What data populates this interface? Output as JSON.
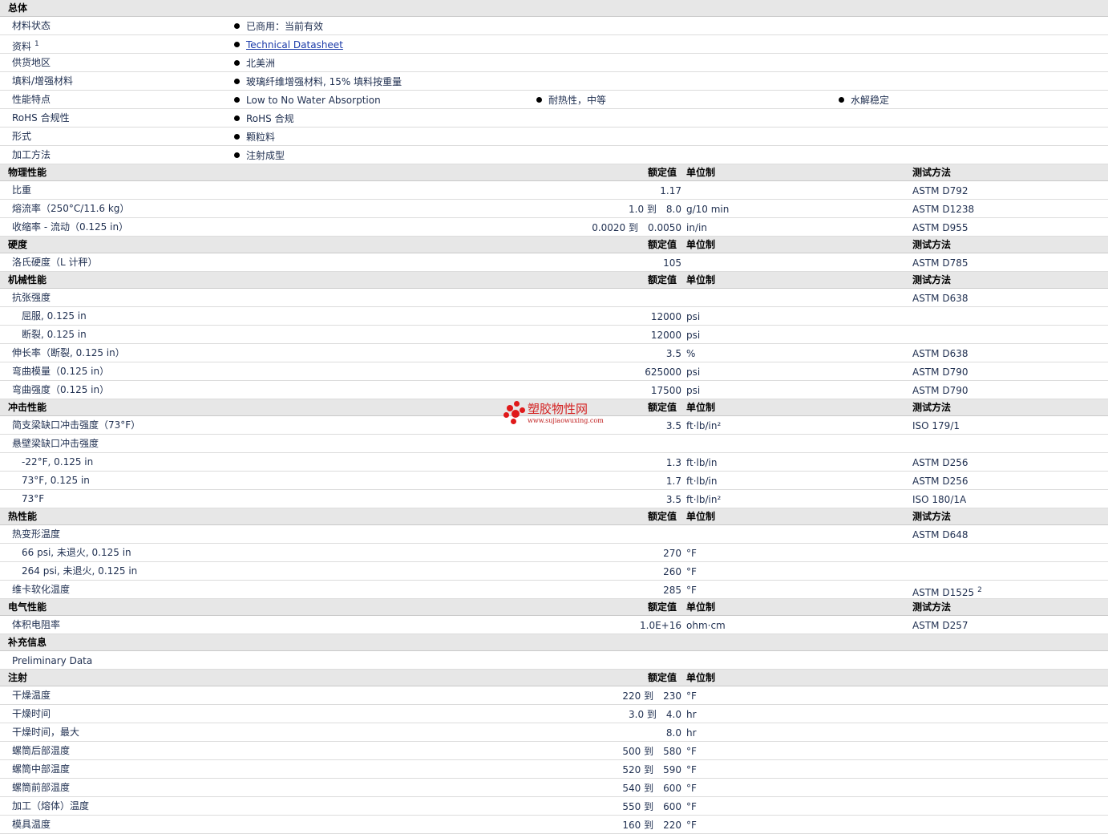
{
  "general": {
    "title": "总体",
    "rows": [
      {
        "label": "材料状态",
        "values": [
          "已商用：当前有效"
        ]
      },
      {
        "label": "资料",
        "sup": "1",
        "values": [
          "Technical Datasheet"
        ],
        "link": true
      },
      {
        "label": "供货地区",
        "values": [
          "北美洲"
        ]
      },
      {
        "label": "填料/增强材料",
        "values": [
          "玻璃纤维增强材料, 15% 填料按重量"
        ]
      },
      {
        "label": "性能特点",
        "values": [
          "Low to No Water Absorption",
          "耐热性，中等",
          "水解稳定"
        ]
      },
      {
        "label": "RoHS 合规性",
        "values": [
          "RoHS 合规"
        ]
      },
      {
        "label": "形式",
        "values": [
          "颗粒料"
        ]
      },
      {
        "label": "加工方法",
        "values": [
          "注射成型"
        ]
      }
    ]
  },
  "headers": {
    "nominal": "额定值",
    "unit": "单位制",
    "method": "测试方法"
  },
  "physical": {
    "title": "物理性能",
    "rows": [
      {
        "label": "比重",
        "nominal": "1.17",
        "unit": "",
        "method": "ASTM D792"
      },
      {
        "label": "熔流率（250°C/11.6 kg）",
        "nominal": "1.0 到　8.0",
        "unit": "g/10 min",
        "method": "ASTM D1238"
      },
      {
        "label": "收缩率 - 流动（0.125 in）",
        "nominal": "0.0020 到　0.0050",
        "unit": "in/in",
        "method": "ASTM D955"
      }
    ]
  },
  "hardness": {
    "title": "硬度",
    "rows": [
      {
        "label": "洛氏硬度（L 计秤）",
        "nominal": "105",
        "unit": "",
        "method": "ASTM D785"
      }
    ]
  },
  "mechanical": {
    "title": "机械性能",
    "rows": [
      {
        "label": "抗张强度",
        "nominal": "",
        "unit": "",
        "method": "ASTM D638"
      },
      {
        "label": "屈服, 0.125 in",
        "sub": true,
        "nominal": "12000",
        "unit": "psi",
        "method": ""
      },
      {
        "label": "断裂, 0.125 in",
        "sub": true,
        "nominal": "12000",
        "unit": "psi",
        "method": ""
      },
      {
        "label": "伸长率（断裂, 0.125 in）",
        "nominal": "3.5",
        "unit": "%",
        "method": "ASTM D638"
      },
      {
        "label": "弯曲模量（0.125 in）",
        "nominal": "625000",
        "unit": "psi",
        "method": "ASTM D790"
      },
      {
        "label": "弯曲强度（0.125 in）",
        "nominal": "17500",
        "unit": "psi",
        "method": "ASTM D790"
      }
    ]
  },
  "impact": {
    "title": "冲击性能",
    "rows": [
      {
        "label": "简支梁缺口冲击强度（73°F）",
        "nominal": "3.5",
        "unit": "ft·lb/in²",
        "method": "ISO 179/1"
      },
      {
        "label": "悬壁梁缺口冲击强度",
        "nominal": "",
        "unit": "",
        "method": ""
      },
      {
        "label": "-22°F, 0.125 in",
        "sub": true,
        "nominal": "1.3",
        "unit": "ft·lb/in",
        "method": "ASTM D256"
      },
      {
        "label": "73°F, 0.125 in",
        "sub": true,
        "nominal": "1.7",
        "unit": "ft·lb/in",
        "method": "ASTM D256"
      },
      {
        "label": "73°F",
        "sub": true,
        "nominal": "3.5",
        "unit": "ft·lb/in²",
        "method": "ISO 180/1A"
      }
    ]
  },
  "thermal": {
    "title": "热性能",
    "rows": [
      {
        "label": "热变形温度",
        "nominal": "",
        "unit": "",
        "method": "ASTM D648"
      },
      {
        "label": "66 psi, 未退火, 0.125 in",
        "sub": true,
        "nominal": "270",
        "unit": "°F",
        "method": ""
      },
      {
        "label": "264 psi, 未退火, 0.125 in",
        "sub": true,
        "nominal": "260",
        "unit": "°F",
        "method": ""
      },
      {
        "label": "维卡软化温度",
        "nominal": "285",
        "unit": "°F",
        "method": "ASTM D1525",
        "method_sup": "2"
      }
    ]
  },
  "electrical": {
    "title": "电气性能",
    "rows": [
      {
        "label": "体积电阻率",
        "nominal": "1.0E+16",
        "unit": "ohm·cm",
        "method": "ASTM D257"
      }
    ]
  },
  "supplement": {
    "title": "补充信息",
    "rows": [
      {
        "label": "Preliminary Data"
      }
    ]
  },
  "injection": {
    "title": "注射",
    "rows": [
      {
        "label": "干燥温度",
        "nominal": "220 到　230",
        "unit": "°F"
      },
      {
        "label": "干燥时间",
        "nominal": "3.0 到　4.0",
        "unit": "hr"
      },
      {
        "label": "干燥时间，最大",
        "nominal": "8.0",
        "unit": "hr"
      },
      {
        "label": "螺筒后部温度",
        "nominal": "500 到　580",
        "unit": "°F"
      },
      {
        "label": "螺筒中部温度",
        "nominal": "520 到　590",
        "unit": "°F"
      },
      {
        "label": "螺筒前部温度",
        "nominal": "540 到　600",
        "unit": "°F"
      },
      {
        "label": "加工（熔体）温度",
        "nominal": "550 到　600",
        "unit": "°F"
      },
      {
        "label": "模具温度",
        "nominal": "160 到　220",
        "unit": "°F"
      }
    ]
  },
  "watermark": {
    "title": "塑胶物性网",
    "url": "www.sujiaowuxing.com"
  }
}
